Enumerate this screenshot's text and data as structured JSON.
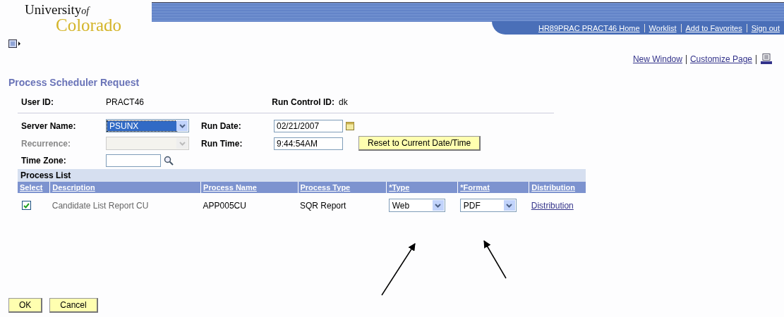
{
  "logo": {
    "line_1": "University",
    "of": "of",
    "line_2": "Colorado"
  },
  "header_links": [
    "HR89PRAC PRACT46 Home",
    "Worklist",
    "Add to Favorites",
    "Sign out"
  ],
  "page_links": [
    "New Window",
    "Customize Page"
  ],
  "title": "Process Scheduler Request",
  "user_id": {
    "label": "User ID:",
    "value": "PRACT46"
  },
  "run_control_id": {
    "label": "Run Control ID:",
    "value": "dk"
  },
  "fields": [
    {
      "label": "Server Name:",
      "kind": "select",
      "value": "PSUNX",
      "disabled": false,
      "focused": true
    },
    {
      "label": "Run Date:",
      "kind": "date",
      "value": "02/21/2007",
      "disabled": false
    },
    {
      "label": "Recurrence:",
      "kind": "select",
      "disabled": true,
      "focused": false
    },
    {
      "label": "Run Time:",
      "kind": "text",
      "value": "9:44:54AM",
      "disabled": false
    },
    {
      "label": "Time Zone:",
      "kind": "lookup",
      "disabled": false
    }
  ],
  "reset_button": "Reset to Current Date/Time",
  "process_list": {
    "title": "Process List",
    "columns": [
      "Select",
      "Description",
      "Process Name",
      "Process Type",
      "*Type",
      "*Format",
      "Distribution"
    ],
    "rows": [
      {
        "selected": true,
        "description": "Candidate List Report CU",
        "process_name": "APP005CU",
        "process_type": "SQR Report",
        "type": "Web",
        "format": "PDF",
        "distribution": "Distribution"
      }
    ]
  },
  "buttons": [
    "OK",
    "Cancel"
  ]
}
